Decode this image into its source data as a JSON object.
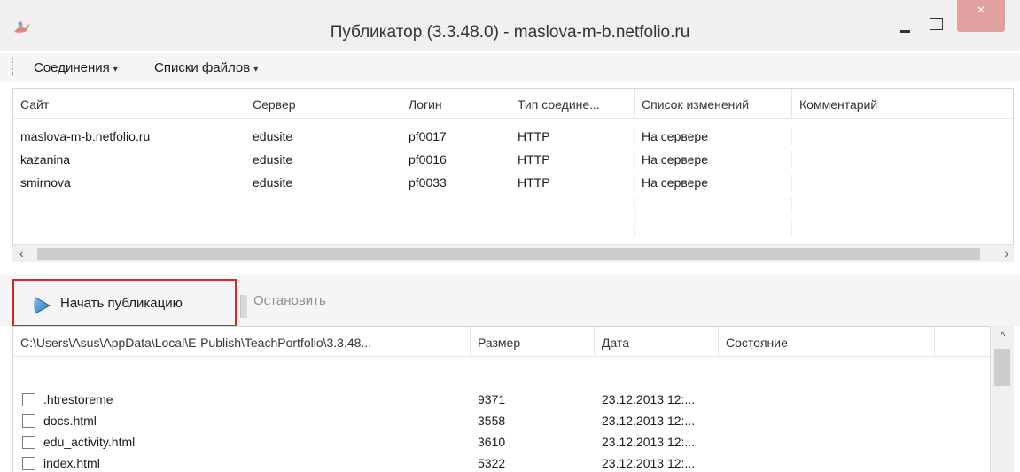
{
  "window": {
    "title": "Публикатор (3.3.48.0) - maslova-m-b.netfolio.ru",
    "close_glyph": "×",
    "icons": {
      "app": "publisher-app-icon",
      "minimize": "minimize-icon",
      "maximize": "maximize-icon",
      "close": "close-icon"
    }
  },
  "menu": {
    "items": [
      {
        "label": "Соединения",
        "arrow": "▾"
      },
      {
        "label": "Списки файлов",
        "arrow": "▾"
      }
    ]
  },
  "sites_table": {
    "headers": [
      "Сайт",
      "Сервер",
      "Логин",
      "Тип соедине...",
      "Список изменений",
      "Комментарий"
    ],
    "rows": [
      [
        "maslova-m-b.netfolio.ru",
        "edusite",
        "pf0017",
        "HTTP",
        "На сервере",
        ""
      ],
      [
        "kazanina",
        "edusite",
        "pf0016",
        "HTTP",
        "На сервере",
        ""
      ],
      [
        "smirnova",
        "edusite",
        "pf0033",
        "HTTP",
        "На сервере",
        ""
      ]
    ],
    "scroll_left": "‹",
    "scroll_right": "›"
  },
  "toolbar": {
    "start_label": "Начать публикацию",
    "stop_label": "Остановить",
    "start_icon": "play-arrow-icon"
  },
  "files_table": {
    "headers": [
      "C:\\Users\\Asus\\AppData\\Local\\E-Publish\\TeachPortfolio\\3.3.48...",
      "Размер",
      "Дата",
      "Состояние",
      ""
    ],
    "rows": [
      {
        "name": ".htrestoreme",
        "size": "9371",
        "date": "23.12.2013 12:...",
        "checked": false
      },
      {
        "name": "docs.html",
        "size": "3558",
        "date": "23.12.2013 12:...",
        "checked": false
      },
      {
        "name": "edu_activity.html",
        "size": "3610",
        "date": "23.12.2013 12:...",
        "checked": false
      },
      {
        "name": "index.html",
        "size": "5322",
        "date": "23.12.2013 12:...",
        "checked": false
      }
    ],
    "scroll_up": "^"
  },
  "colors": {
    "highlight_border": "#d9262b",
    "close_button": "#e3a0a0",
    "play_icon": "#3a8fd6"
  }
}
